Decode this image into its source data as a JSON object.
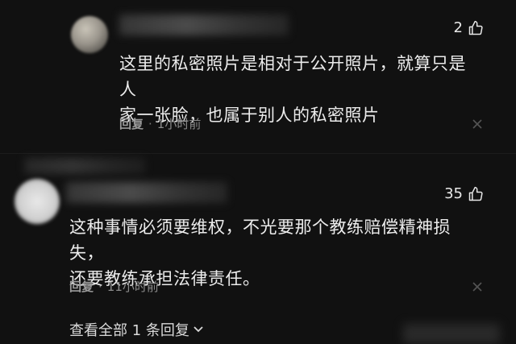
{
  "comments": [
    {
      "likes": "2",
      "text": "这里的私密照片是相对于公开照片，就算只是人\n家一张脸，也属于别人的私密照片",
      "reply_label": "回复",
      "time": "1小时前"
    },
    {
      "likes": "35",
      "text": "这种事情必须要维权，不光要那个教练赔偿精神损失，\n还要教练承担法律责任。",
      "reply_label": "回复",
      "time": "11小时前"
    }
  ],
  "view_replies_label": "查看全部 1 条回复",
  "separator": "·",
  "icons": {
    "like": "thumbs-up-icon",
    "close": "close-icon",
    "expand": "chevron-down-icon"
  },
  "colors": {
    "background": "#111111",
    "text": "#ececec",
    "meta": "#8a8a8a"
  }
}
